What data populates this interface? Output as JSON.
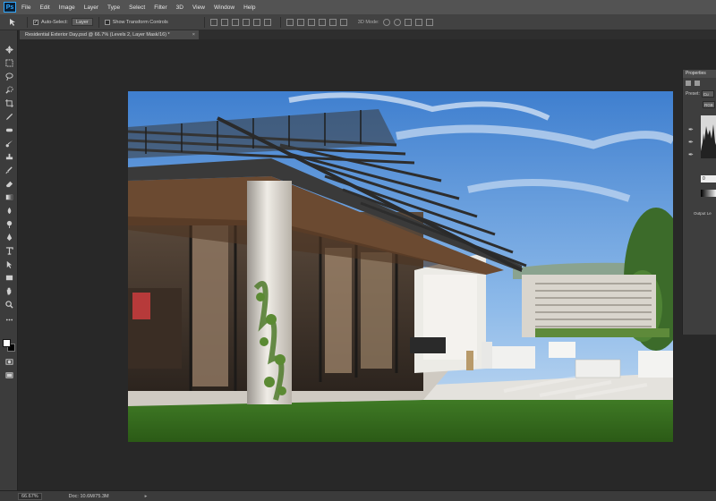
{
  "app": {
    "logo": "Ps",
    "menus": [
      "File",
      "Edit",
      "Image",
      "Layer",
      "Type",
      "Select",
      "Filter",
      "3D",
      "View",
      "Window",
      "Help"
    ]
  },
  "options_bar": {
    "auto_select_label": "Auto-Select:",
    "auto_select_value": "Layer",
    "show_transform_label": "Show Transform Controls",
    "mode_3d_label": "3D Mode:"
  },
  "document": {
    "tab_title": "Residential Exterior Day.psd @ 66.7% (Levels 2, Layer Mask/16) *",
    "zoom": "66.67%",
    "doc_info": "Doc: 10.6M/75.3M"
  },
  "properties_panel": {
    "title": "Properties",
    "preset_label": "Preset:",
    "preset_value": "Cu",
    "channel_value": "RGB",
    "input_value": "0",
    "output_label": "Output Le"
  },
  "colors": {
    "menubar_bg": "#535353",
    "optionsbar_bg": "#424242",
    "workspace_bg": "#282828",
    "panel_bg": "#3e3e3e",
    "foreground_swatch": "#ffffff",
    "background_swatch": "#000000"
  },
  "tools": [
    "move-tool",
    "marquee-tool",
    "lasso-tool",
    "quick-select-tool",
    "crop-tool",
    "eyedropper-tool",
    "healing-brush-tool",
    "brush-tool",
    "clone-stamp-tool",
    "history-brush-tool",
    "eraser-tool",
    "gradient-tool",
    "blur-tool",
    "dodge-tool",
    "pen-tool",
    "type-tool",
    "path-select-tool",
    "shape-tool",
    "hand-tool",
    "zoom-tool"
  ]
}
